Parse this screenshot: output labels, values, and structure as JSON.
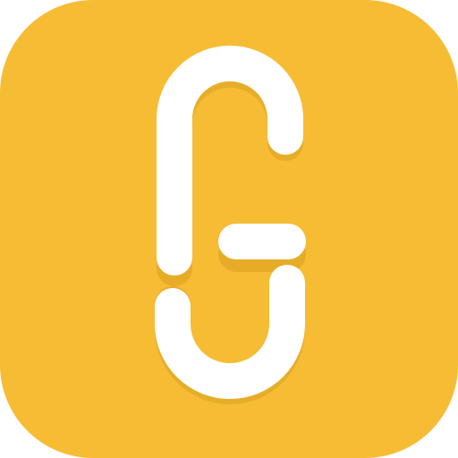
{
  "icon": {
    "name": "app-logo-g-icon",
    "background_color": "#F6BC33",
    "mark_color": "#FFFFFF",
    "shadow_color": "#D9A020"
  }
}
